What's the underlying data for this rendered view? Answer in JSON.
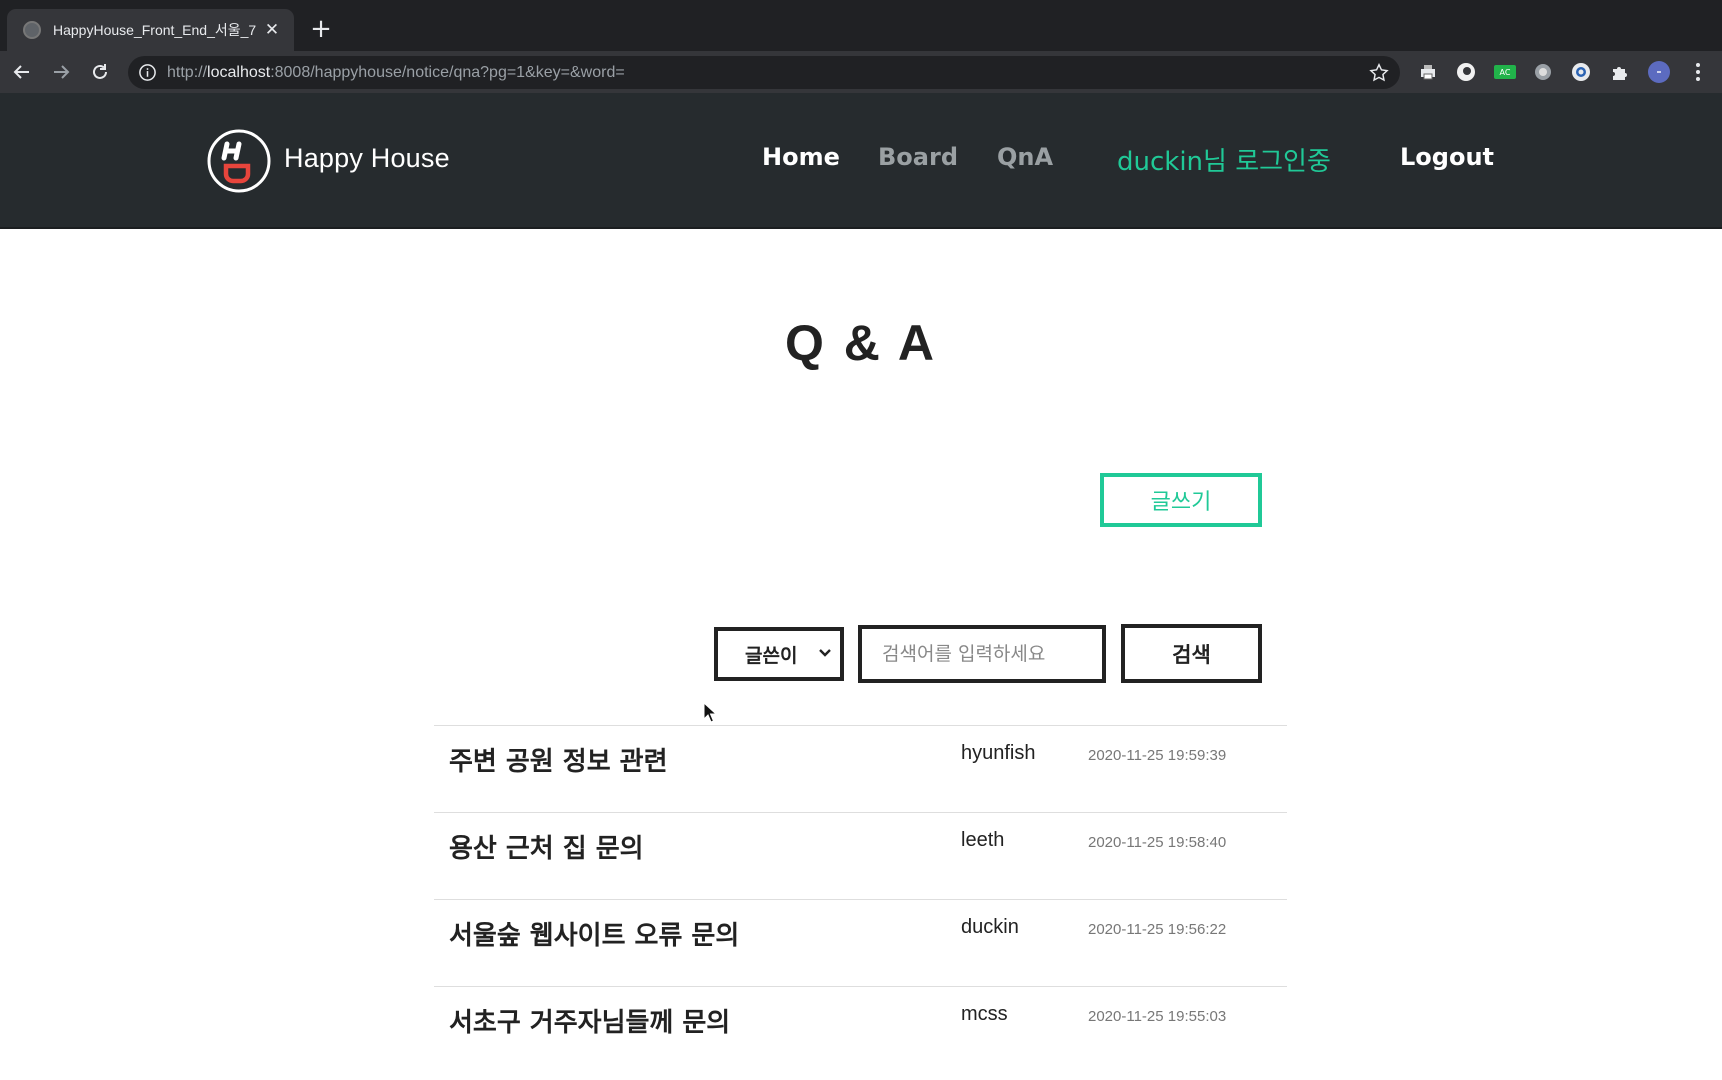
{
  "browser": {
    "tab_title": "HappyHouse_Front_End_서울_7",
    "tab_close": "✕",
    "new_tab": "+",
    "url_prefix": "http://",
    "url_host": "localhost",
    "url_rest": ":8008/happyhouse/notice/qna?pg=1&key=&word="
  },
  "header": {
    "brand": "Happy House",
    "nav": {
      "home": "Home",
      "board": "Board",
      "qna": "QnA",
      "user_status": "duckin님 로그인중",
      "logout": "Logout"
    },
    "accent_color": "#20c997"
  },
  "main": {
    "title": "Q & A",
    "write_button": "글쓰기",
    "search": {
      "selected_key": "글쓴이",
      "placeholder": "검색어를 입력하세요",
      "button": "검색"
    },
    "posts": [
      {
        "title": "주변 공원 정보 관련",
        "author": "hyunfish",
        "date": "2020-11-25 19:59:39"
      },
      {
        "title": "용산 근처 집 문의",
        "author": "leeth",
        "date": "2020-11-25 19:58:40"
      },
      {
        "title": "서울숲 웹사이트 오류 문의",
        "author": "duckin",
        "date": "2020-11-25 19:56:22"
      },
      {
        "title": "서초구 거주자님들께 문의",
        "author": "mcss",
        "date": "2020-11-25 19:55:03"
      }
    ]
  }
}
